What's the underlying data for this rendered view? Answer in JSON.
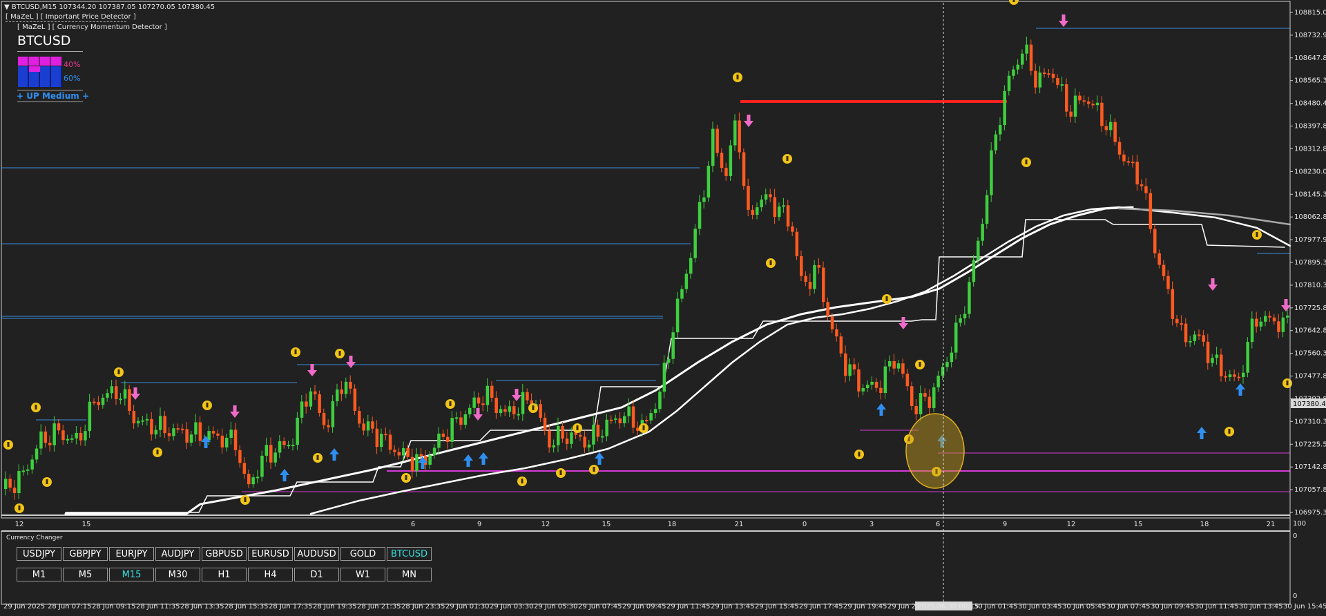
{
  "header": {
    "symbol_line": "▼ BTCUSD,M15  107344.20 107387.05 107270.05 107380.45",
    "indicator1": "[ MaZeL ] [ Important Price Detector ]",
    "indicator2": "[ MaZeL ] [ Currency Momentum Detector ]"
  },
  "panel": {
    "symbol": "BTCUSD",
    "pct_top": "40%",
    "pct_bottom": "60%",
    "signal": "+ UP Medium +"
  },
  "price_axis": [
    "108815.05",
    "108732.90",
    "108647.80",
    "108565.30",
    "108480.40",
    "108397.80",
    "108312.85",
    "108230.00",
    "108145.30",
    "108062.80",
    "107977.90",
    "107895.30",
    "107810.35",
    "107725.80",
    "107642.80",
    "107560.30",
    "107477.80",
    "107392.85",
    "107380.45",
    "107310.30",
    "107225.50",
    "107142.80",
    "107057.80",
    "106975.30"
  ],
  "current_price": "107380.45",
  "bottom_axis_labels": [
    "100",
    "0",
    "0"
  ],
  "bar_axis": [
    "12",
    "15",
    "6",
    "9",
    "12",
    "15",
    "18",
    "21",
    "0",
    "3",
    "6",
    "9",
    "12",
    "15",
    "18",
    "21"
  ],
  "time_axis": [
    "29 Jun 2025",
    "28 Jun 07:15",
    "28 Jun 09:15",
    "28 Jun 11:35",
    "28 Jun 13:35",
    "28 Jun 15:35",
    "28 Jun 17:35",
    "28 Jun 19:35",
    "28 Jun 21:35",
    "28 Jun 23:35",
    "29 Jun 01:30",
    "29 Jun 03:30",
    "29 Jun 05:30",
    "29 Jun 07:45",
    "29 Jun 09:45",
    "29 Jun 11:45",
    "29 Jun 13:45",
    "29 Jun 15:45",
    "29 Jun 17:45",
    "29 Jun 19:45",
    "29 Jun 21",
    "2025.06.30 00:15",
    "30 Jun 01:45",
    "30 Jun 03:45",
    "30 Jun 05:45",
    "30 Jun 07:45",
    "30 Jun 09:45",
    "30 Jun 11:45",
    "30 Jun 13:45",
    "30 Jun 15:45"
  ],
  "currency_changer": {
    "title": "Currency Changer",
    "symbols": [
      "USDJPY",
      "GBPJPY",
      "EURJPY",
      "AUDJPY",
      "GBPUSD",
      "EURUSD",
      "AUDUSD",
      "GOLD",
      "BTCUSD"
    ],
    "active_symbol": "BTCUSD",
    "timeframes": [
      "M1",
      "M5",
      "M15",
      "M30",
      "H1",
      "H4",
      "D1",
      "W1",
      "MN"
    ],
    "active_timeframe": "M15"
  },
  "colors": {
    "background": "#212121",
    "bull": "#3ecf3e",
    "bear": "#ff5a1f",
    "level_line": "#3a8ee0",
    "magenta_line": "#d63ad6",
    "resistance": "#ff2020",
    "arrow_up": "#2f8ff0",
    "arrow_down": "#f06ac8",
    "signal_coin": "#f0c419",
    "highlight": "#c8a020"
  }
}
